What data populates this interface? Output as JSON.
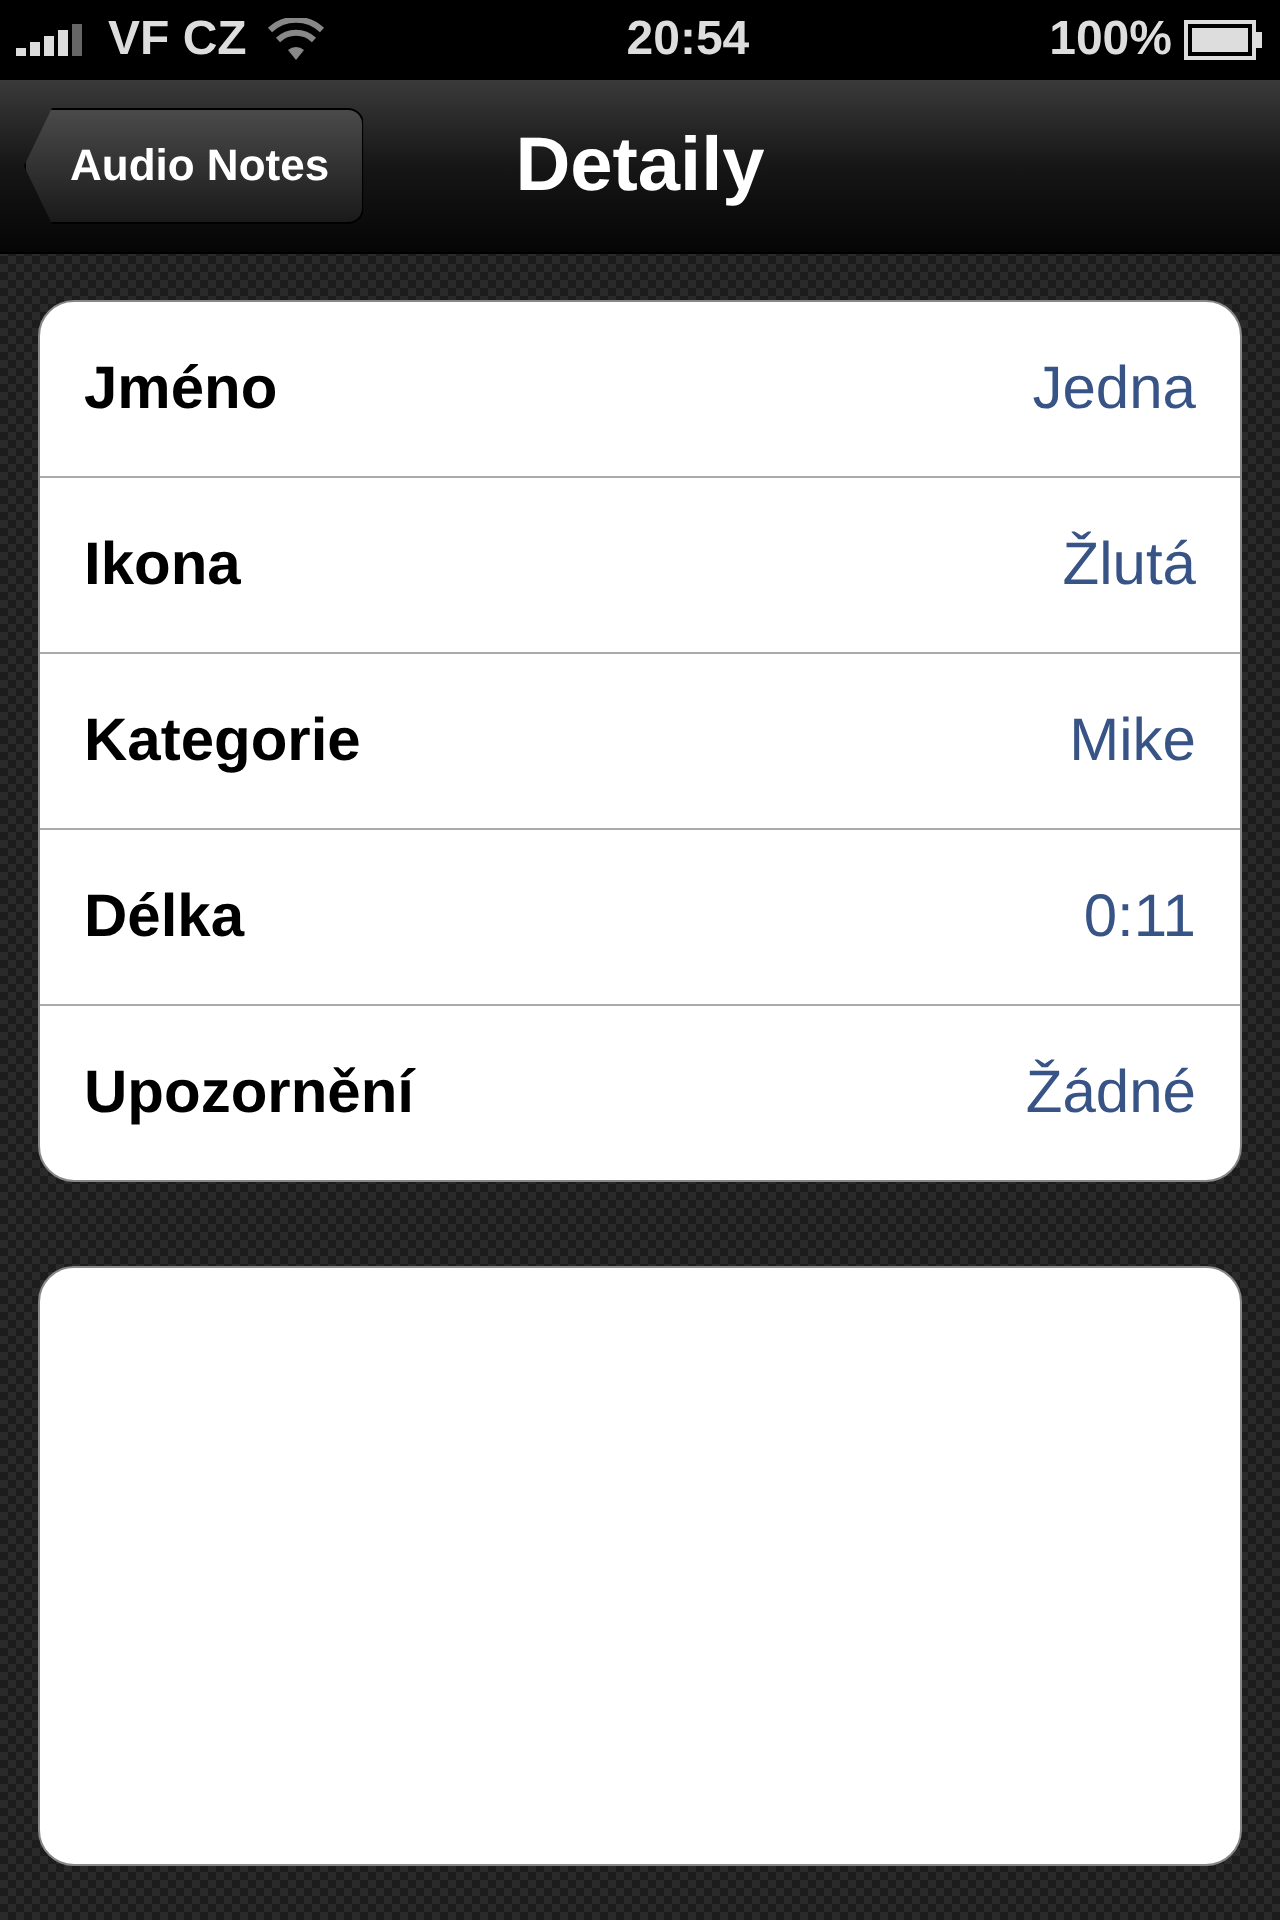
{
  "status_bar": {
    "carrier": "VF CZ",
    "time": "20:54",
    "battery": "100%"
  },
  "nav_bar": {
    "back": "Audio Notes",
    "title": "Detaily"
  },
  "details": [
    {
      "label": "Jméno",
      "value": "Jedna"
    },
    {
      "label": "Ikona",
      "value": "Žlutá"
    },
    {
      "label": "Kategorie",
      "value": "Mike"
    },
    {
      "label": "Délka",
      "value": "0:11"
    },
    {
      "label": "Upozornění",
      "value": "Žádné"
    }
  ],
  "notes": {
    "kind": "text-area"
  }
}
